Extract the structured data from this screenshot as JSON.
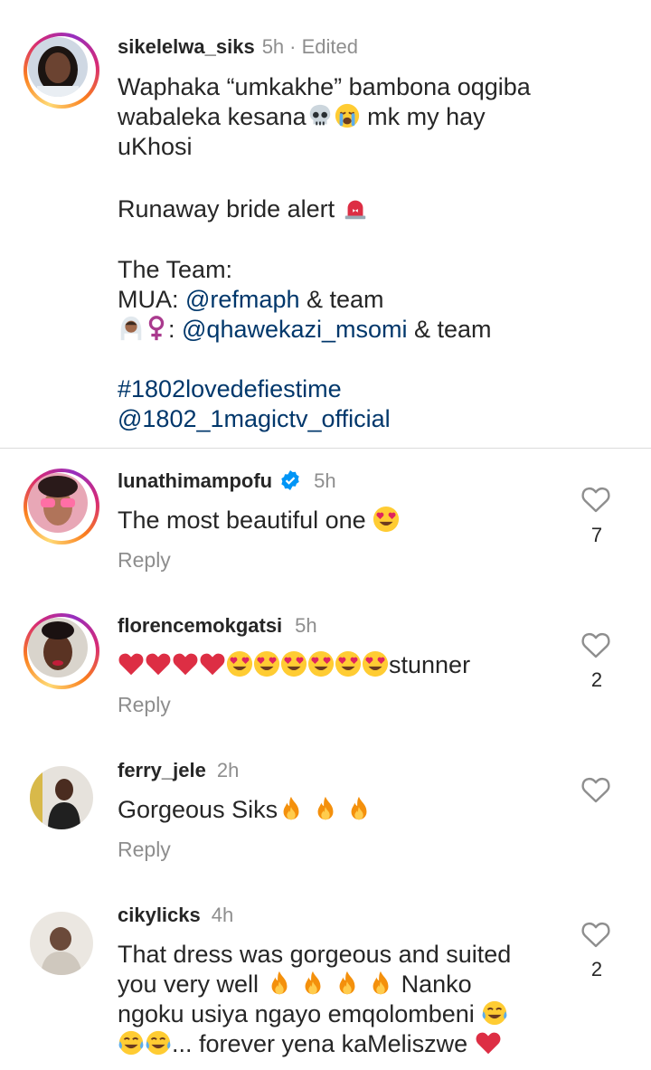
{
  "caption": {
    "username": "sikelelwa_siks",
    "time": "5h",
    "edited": "· Edited",
    "line1": "Waphaka “umkakhe” bambona oqgiba",
    "line2": "wabaleka kesana",
    "line2_tail": " mk my hay",
    "line3": "uKhosi",
    "line4": "Runaway bride alert ",
    "line5": "The Team:",
    "line6_prefix": "MUA: ",
    "line6_mention": "@refmaph",
    "line6_suffix": " & team",
    "line7_sep": ": ",
    "line7_mention": "@qhawekazi_msomi",
    "line7_suffix": " & team",
    "hashtag": "#1802lovedefiestime",
    "mention_official": "@1802_1magictv_official"
  },
  "comments": [
    {
      "username": "lunathimampofu",
      "verified": true,
      "time": "5h",
      "text": "The most beautiful one ",
      "reply": "Reply",
      "likes": "7"
    },
    {
      "username": "florencemokgatsi",
      "time": "5h",
      "text": "stunner",
      "reply": "Reply",
      "likes": "2"
    },
    {
      "username": "ferry_jele",
      "time": "2h",
      "text": "Gorgeous Siks",
      "reply": "Reply",
      "likes": ""
    },
    {
      "username": "cikylicks",
      "time": "4h",
      "line1": "That dress was gorgeous and suited",
      "line2": "you very well ",
      "line2_tail": " Nanko",
      "line3": "ngoku usiya ngayo emqolombeni ",
      "line4": "... forever yena kaMeliszwe ",
      "likes": "2"
    }
  ],
  "colors": {
    "link": "#00376b",
    "muted": "#8e8e8e",
    "verified": "#0095f6",
    "heart": "#e0245e"
  },
  "icons": [
    "skull-icon",
    "crying-face-icon",
    "siren-icon",
    "bride-icon",
    "female-sign-icon",
    "verified-badge-icon",
    "heart-eyes-icon",
    "red-heart-icon",
    "fire-icon",
    "tears-of-joy-icon",
    "like-heart-icon"
  ]
}
